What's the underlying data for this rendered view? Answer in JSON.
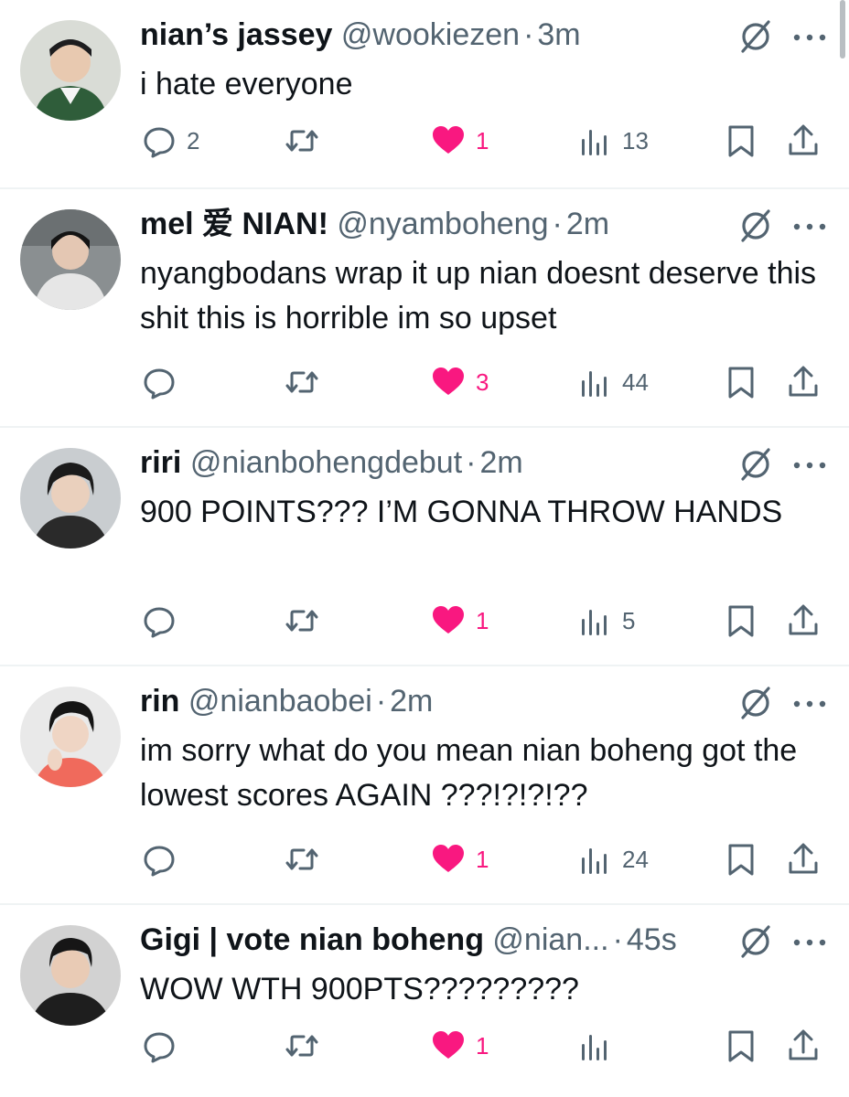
{
  "tweets": [
    {
      "name": "nian’s jassey",
      "handle": "@wookiezen",
      "time": "3m",
      "text": "i hate everyone",
      "replies": "2",
      "likes": "1",
      "views": "13",
      "liked": true
    },
    {
      "name": "mel 爱 NIAN!",
      "handle": "@nyamboheng",
      "time": "2m",
      "text": "nyangbodans wrap it up nian doesnt deserve this shit this is horrible im so upset",
      "replies": "",
      "likes": "3",
      "views": "44",
      "liked": true
    },
    {
      "name": "riri",
      "handle": "@nianbohengdebut",
      "time": "2m",
      "text": "900 POINTS??? I’M GONNA THROW HANDS",
      "replies": "",
      "likes": "1",
      "views": "5",
      "liked": true
    },
    {
      "name": "rin",
      "handle": "@nianbaobei",
      "time": "2m",
      "text": "im sorry what do you mean nian boheng got the lowest scores AGAIN ???!?!?!??",
      "replies": "",
      "likes": "1",
      "views": "24",
      "liked": true
    },
    {
      "name": "Gigi | vote nian boheng",
      "handle": "@nian...",
      "time": "45s",
      "text": "WOW WTH 900PTS?????????",
      "replies": "",
      "likes": "1",
      "views": "",
      "liked": true
    }
  ],
  "separator": "·",
  "icons": {
    "reply": "reply-icon",
    "retweet": "retweet-icon",
    "like": "heart-icon",
    "views": "views-icon",
    "bookmark": "bookmark-icon",
    "share": "share-icon",
    "grok": "grok-icon",
    "more": "more-icon"
  },
  "colors": {
    "text": "#0f1419",
    "secondary": "#536471",
    "like": "#f91880",
    "divider": "#eff3f4"
  }
}
